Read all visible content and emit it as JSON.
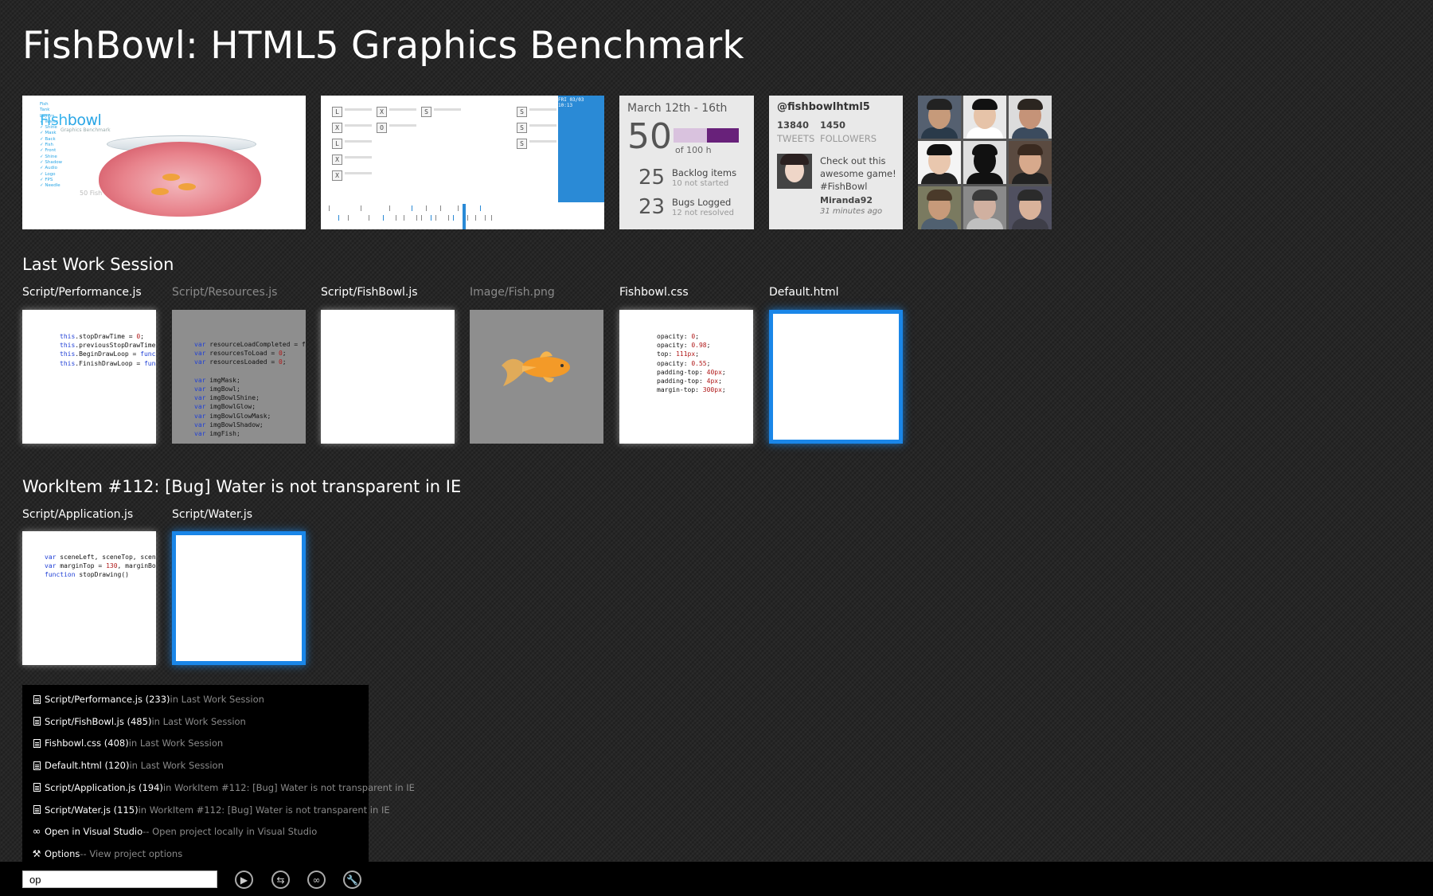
{
  "app": {
    "title": "FishBowl: HTML5 Graphics Benchmark"
  },
  "tiles": {
    "fishbowl": {
      "logo_prefix": "Fish",
      "logo_suffix": "bowl",
      "subtitle": "Graphics Benchmark",
      "features": [
        "Fish",
        "Tank",
        "Layers",
        "Water",
        "Shine",
        "Mask",
        "Back",
        "Fish",
        "Front",
        "Shine",
        "Shadow",
        "Audio",
        "Logo",
        "FPS",
        "Needle"
      ],
      "caption": "50 Fish"
    },
    "timeline": {
      "header": "FRI 03/03 10:13",
      "box_glyphs": [
        "L",
        "X",
        "X",
        "O",
        "L",
        "X",
        "X",
        "S",
        "S",
        "S",
        "S",
        "X",
        "L"
      ]
    },
    "stats": {
      "date_range": "March 12th - 16th",
      "hours_done": "50",
      "hours_total_label": "of 100 h",
      "progress_fraction": 0.5,
      "backlog_count": "25",
      "backlog_label": "Backlog items",
      "backlog_sub": "10 not started",
      "bugs_count": "23",
      "bugs_label": "Bugs Logged",
      "bugs_sub": "12 not resolved"
    },
    "twitter": {
      "handle": "@fishbowlhtml5",
      "tweets_count": "13840",
      "followers_count": "1450",
      "tweets_label": "TWEETS",
      "followers_label": "FOLLOWERS",
      "message": "Check out this awesome game! #FishBowl",
      "user": "Miranda92",
      "time": "31 minutes ago"
    }
  },
  "last_session": {
    "title": "Last Work Session",
    "files": [
      {
        "name": "Script/Performance.js",
        "dim": false
      },
      {
        "name": "Script/Resources.js",
        "dim": true
      },
      {
        "name": "Script/FishBowl.js",
        "dim": false
      },
      {
        "name": "Image/Fish.png",
        "dim": true
      },
      {
        "name": "Fishbowl.css",
        "dim": false
      },
      {
        "name": "Default.html",
        "dim": false
      }
    ],
    "code_performance": [
      "this.stopDrawTime = 0;",
      "this.previousStopDrawTime",
      "this.BeginDrawLoop = func",
      "this.FinishDrawLoop = fun"
    ],
    "code_resources": [
      "var resourceLoadCompleted = f",
      "var resourcesToLoad = 0;",
      "var resourcesLoaded = 0;",
      "",
      "var imgMask;",
      "var imgBowl;",
      "var imgBowlShine;",
      "var imgBowlGlow;",
      "var imgBowlGlowMask;",
      "var imgBowlShadow;",
      "var imgFish;"
    ],
    "code_css": [
      "opacity: 0;",
      "opacity: 0.98;",
      "top: 111px;",
      "opacity: 0.55;",
      "padding-top: 40px;",
      "padding-top: 4px;",
      "margin-top: 300px;"
    ]
  },
  "workitem": {
    "title": "WorkItem #112: [Bug] Water is not transparent in IE",
    "files": [
      {
        "name": "Script/Application.js"
      },
      {
        "name": "Script/Water.js"
      }
    ],
    "code_application": [
      "var sceneLeft, sceneTop, scen",
      "var marginTop = 130, marginBo",
      "function stopDrawing()"
    ]
  },
  "results": [
    {
      "icon": "document-icon",
      "label": "Script/Performance.js (233)",
      "context": " in Last Work Session"
    },
    {
      "icon": "document-icon",
      "label": "Script/FishBowl.js (485)",
      "context": " in Last Work Session"
    },
    {
      "icon": "document-icon",
      "label": "Fishbowl.css (408)",
      "context": " in Last Work Session"
    },
    {
      "icon": "document-icon",
      "label": "Default.html (120)",
      "context": " in Last Work Session"
    },
    {
      "icon": "document-icon",
      "label": "Script/Application.js (194)",
      "context": " in WorkItem #112: [Bug] Water is not transparent in IE"
    },
    {
      "icon": "document-icon",
      "label": "Script/Water.js (115)",
      "context": " in WorkItem #112: [Bug] Water is not transparent in IE"
    },
    {
      "icon": "visual-studio-icon",
      "label": "Open in Visual Studio",
      "context": " -- Open project locally in Visual Studio"
    },
    {
      "icon": "wrench-icon",
      "label": "Options",
      "context": " -- View project options"
    }
  ],
  "command_bar": {
    "input_value": "op",
    "buttons": [
      "play-icon",
      "swap-icon",
      "visual-studio-icon",
      "wrench-icon"
    ]
  },
  "colors": {
    "accent": "#1a86e8",
    "progress_light": "#d9c2de",
    "progress_dark": "#68217a",
    "timeline_blue": "#2a8ad6"
  }
}
